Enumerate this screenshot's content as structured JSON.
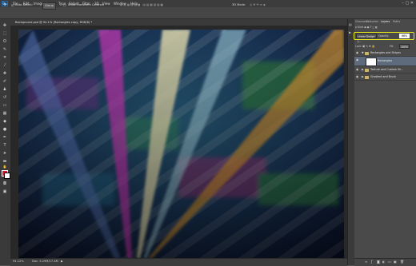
{
  "app": {
    "logo": "Ps",
    "menu": [
      "File",
      "Edit",
      "Image",
      "Layer",
      "Type",
      "Select",
      "Filter",
      "3D",
      "View",
      "Window",
      "Help"
    ],
    "window_controls": "–  □  ✕"
  },
  "options_bar": {
    "style_label": "Auto-Select:",
    "style_value": "Group",
    "show_transform": "Show Transform Controls",
    "mode_label": "3D Mode:"
  },
  "document": {
    "tab_title": "Background.psd @ 94.1% (Rectangles copy, RGB/8) *",
    "zoom": "94.12%",
    "doc_info": "Doc: 3.29M/17.4M"
  },
  "panel": {
    "tabs": [
      "Channels",
      "Histories",
      "Layers",
      "Paths"
    ],
    "active_tab": "Layers",
    "blend_mode": "Linear Dodge (...",
    "opacity_label": "Opacity:",
    "opacity_value": "68%",
    "lock_label": "Lock:",
    "fill_label": "Fill:",
    "fill_value": "100%",
    "layers": [
      {
        "name": "Rectangles and Stripes",
        "type": "group",
        "expanded": true
      },
      {
        "name": "Rectangles",
        "type": "layer",
        "selected": true
      },
      {
        "name": "Texture and Custom Sh...",
        "type": "group",
        "expanded": false
      },
      {
        "name": "Gradient and Brush",
        "type": "group",
        "expanded": false
      }
    ]
  },
  "colors": {
    "foreground": "#e01a3a",
    "background": "#ffffff",
    "highlight": "#e8e817"
  }
}
